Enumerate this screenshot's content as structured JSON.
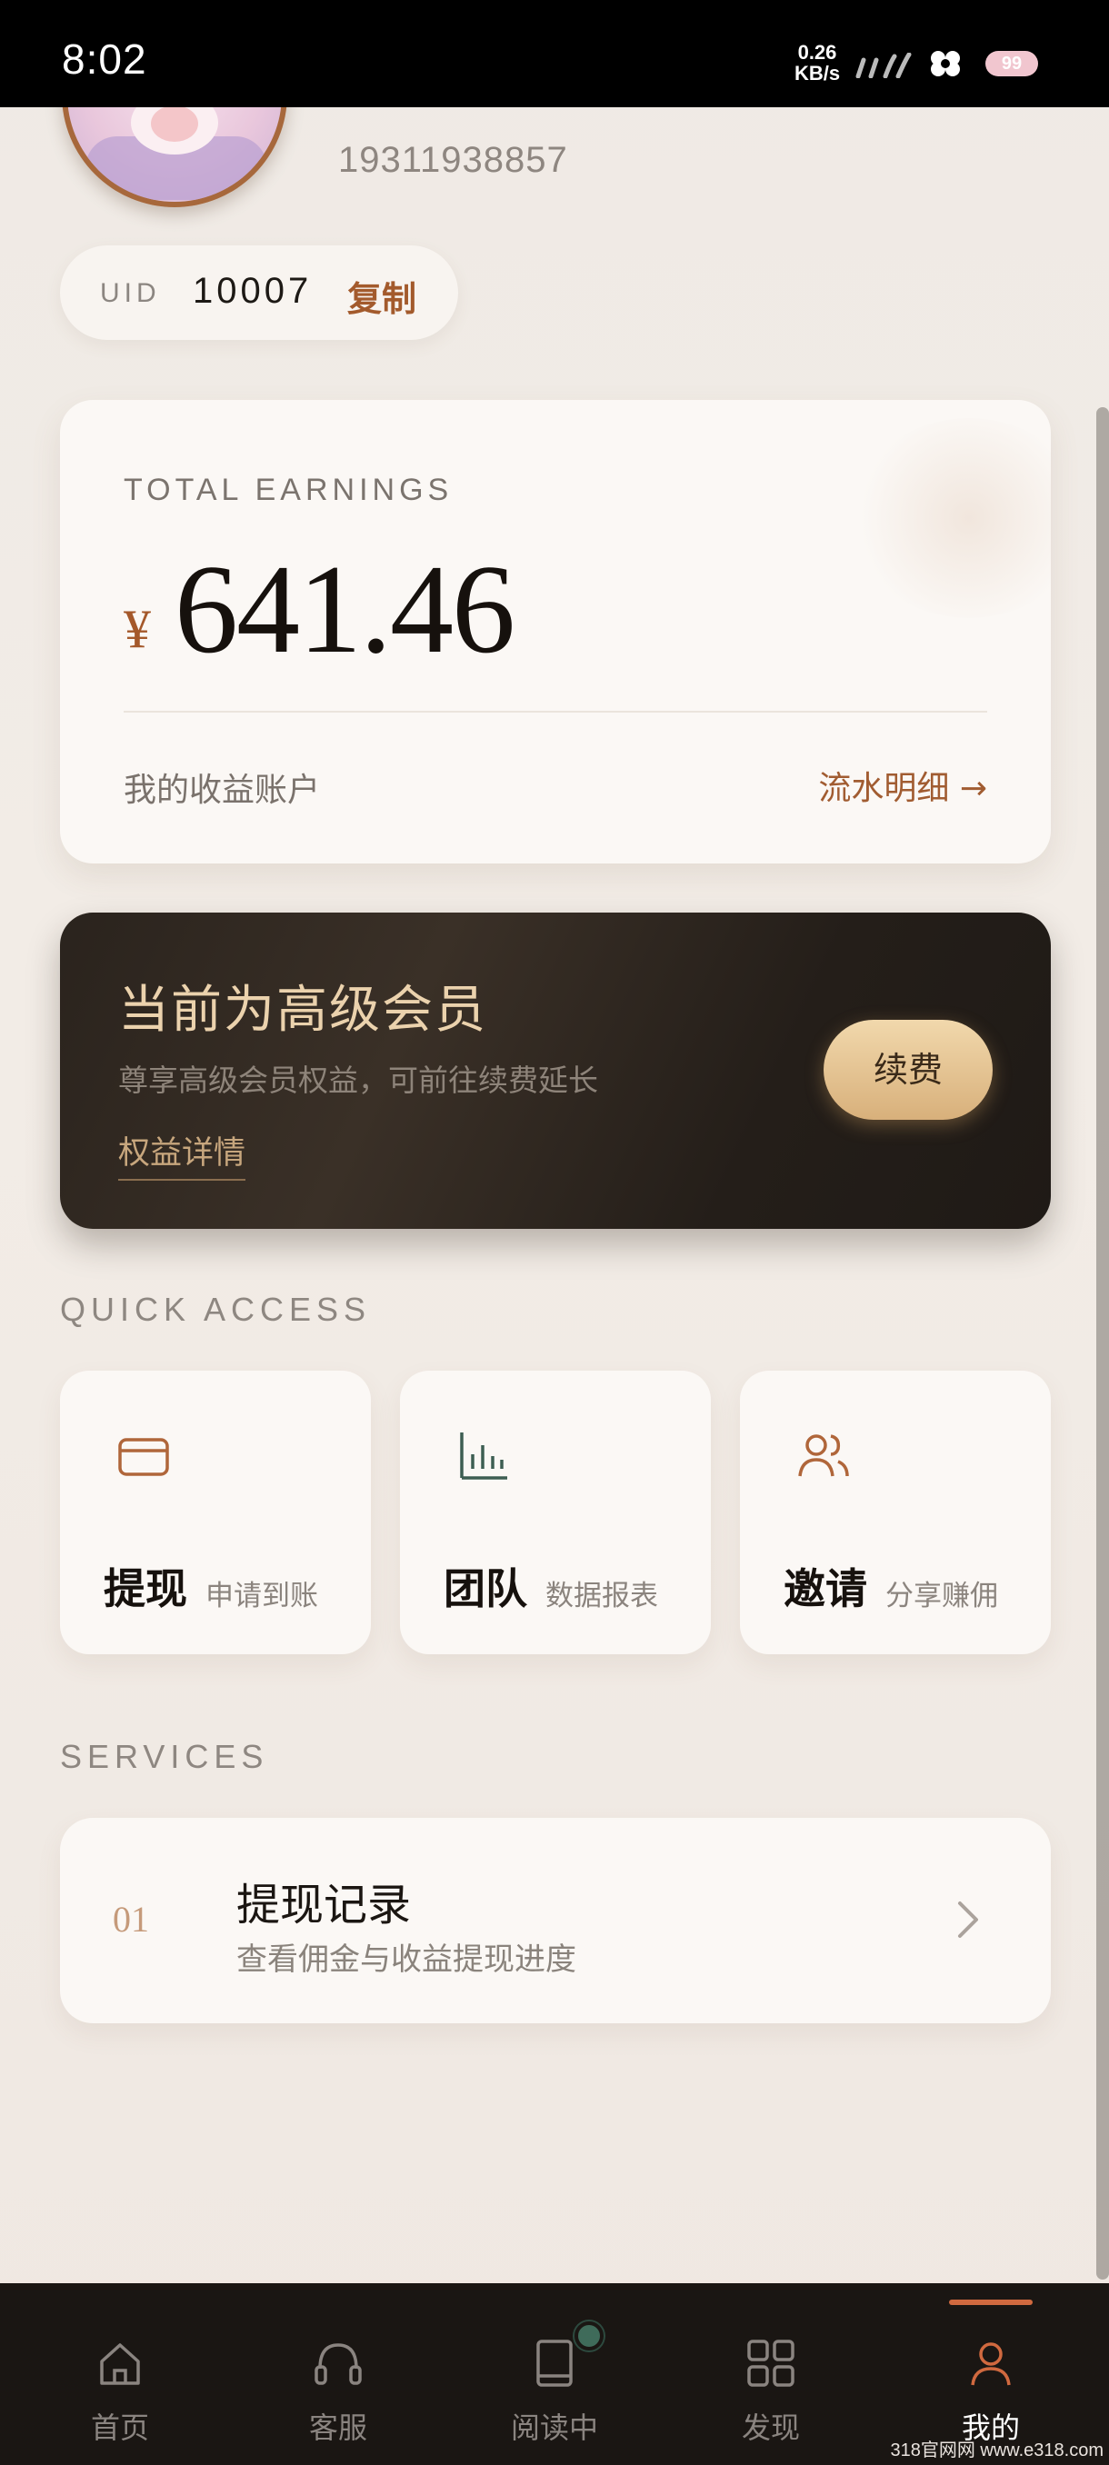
{
  "status_bar": {
    "time": "8:02",
    "net_speed_value": "0.26",
    "net_speed_unit": "KB/s",
    "battery": "99",
    "icons": [
      "signal-icon",
      "wifi-icon",
      "battery-icon"
    ]
  },
  "profile": {
    "phone": "19311938857",
    "uid_label": "UID",
    "uid_value": "10007",
    "copy_label": "复制"
  },
  "earnings": {
    "label": "TOTAL EARNINGS",
    "currency": "¥",
    "amount": "641.46",
    "account_label": "我的收益账户",
    "flow_link": "流水明细 →"
  },
  "membership": {
    "title": "当前为高级会员",
    "description": "尊享高级会员权益，可前往续费延长",
    "benefits_link": "权益详情",
    "renew_button": "续费"
  },
  "quick_access": {
    "section_label": "QUICK ACCESS",
    "items": [
      {
        "title": "提现",
        "subtitle": "申请到账",
        "icon": "card-icon"
      },
      {
        "title": "团队",
        "subtitle": "数据报表",
        "icon": "bar-chart-icon"
      },
      {
        "title": "邀请",
        "subtitle": "分享赚佣",
        "icon": "users-icon"
      }
    ]
  },
  "services": {
    "section_label": "SERVICES",
    "items": [
      {
        "number": "01",
        "title": "提现记录",
        "description": "查看佣金与收益提现进度"
      }
    ]
  },
  "bottom_nav": {
    "items": [
      {
        "label": "首页",
        "icon": "home-icon"
      },
      {
        "label": "客服",
        "icon": "headset-icon"
      },
      {
        "label": "阅读中",
        "icon": "book-icon"
      },
      {
        "label": "发现",
        "icon": "grid-icon"
      },
      {
        "label": "我的",
        "icon": "user-icon",
        "active": true
      }
    ]
  },
  "colors": {
    "accent": "#a35a2c",
    "gold": "#ebd2ad",
    "nav_active": "#d0693f",
    "background": "#efe9e4"
  },
  "watermark": "318官网网 www.e318.com"
}
